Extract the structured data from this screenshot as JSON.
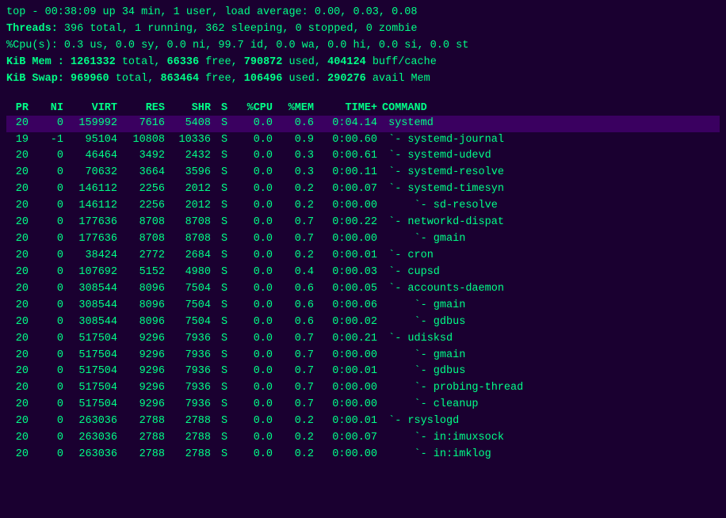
{
  "header": {
    "line1": "top - 00:38:09 up 34 min,  1 user,  load average: 0.00, 0.03, 0.08",
    "line2_label1": "Threads:",
    "line2_val1": " 396 total,",
    "line2_label2": "  1 running,",
    "line2_val2": " 362 sleeping,",
    "line2_label3": "  0 stopped,",
    "line2_val3": "  0 zombie",
    "line3": "%Cpu(s):  0.3 us,  0.0 sy,  0.0 ni, 99.7 id,  0.0 wa,  0.0 hi,  0.0 si,  0.0 st",
    "line4_label1": "KiB Mem :",
    "line4_val1": " 1261332",
    "line4_label2": " total,",
    "line4_val2": "    66336",
    "line4_label3": " free,",
    "line4_val3": "   790872",
    "line4_label4": " used,",
    "line4_val4": "   404124",
    "line4_label5": " buff/cache",
    "line5_label1": "KiB Swap:",
    "line5_val1": "  969960",
    "line5_label2": " total,",
    "line5_val2": "   863464",
    "line5_label3": " free,",
    "line5_val3": "   106496",
    "line5_label4": " used.",
    "line5_val4": "   290276",
    "line5_label5": " avail Mem"
  },
  "columns": [
    "PR",
    "NI",
    "VIRT",
    "RES",
    "SHR",
    "S",
    "%CPU",
    "%MEM",
    "TIME+",
    "COMMAND"
  ],
  "rows": [
    {
      "pr": "20",
      "ni": "0",
      "virt": "159992",
      "res": "7616",
      "shr": "5408",
      "s": "S",
      "cpu": "0.0",
      "mem": "0.6",
      "time": "0:04.14",
      "cmd": "systemd",
      "highlight": true
    },
    {
      "pr": "19",
      "ni": "-1",
      "virt": "95104",
      "res": "10808",
      "shr": "10336",
      "s": "S",
      "cpu": "0.0",
      "mem": "0.9",
      "time": "0:00.60",
      "cmd": "`- systemd-journal"
    },
    {
      "pr": "20",
      "ni": "0",
      "virt": "46464",
      "res": "3492",
      "shr": "2432",
      "s": "S",
      "cpu": "0.0",
      "mem": "0.3",
      "time": "0:00.61",
      "cmd": "`- systemd-udevd"
    },
    {
      "pr": "20",
      "ni": "0",
      "virt": "70632",
      "res": "3664",
      "shr": "3596",
      "s": "S",
      "cpu": "0.0",
      "mem": "0.3",
      "time": "0:00.11",
      "cmd": "`- systemd-resolve"
    },
    {
      "pr": "20",
      "ni": "0",
      "virt": "146112",
      "res": "2256",
      "shr": "2012",
      "s": "S",
      "cpu": "0.0",
      "mem": "0.2",
      "time": "0:00.07",
      "cmd": "`- systemd-timesyn"
    },
    {
      "pr": "20",
      "ni": "0",
      "virt": "146112",
      "res": "2256",
      "shr": "2012",
      "s": "S",
      "cpu": "0.0",
      "mem": "0.2",
      "time": "0:00.00",
      "cmd": "    `- sd-resolve"
    },
    {
      "pr": "20",
      "ni": "0",
      "virt": "177636",
      "res": "8708",
      "shr": "8708",
      "s": "S",
      "cpu": "0.0",
      "mem": "0.7",
      "time": "0:00.22",
      "cmd": "`- networkd-dispat"
    },
    {
      "pr": "20",
      "ni": "0",
      "virt": "177636",
      "res": "8708",
      "shr": "8708",
      "s": "S",
      "cpu": "0.0",
      "mem": "0.7",
      "time": "0:00.00",
      "cmd": "    `- gmain"
    },
    {
      "pr": "20",
      "ni": "0",
      "virt": "38424",
      "res": "2772",
      "shr": "2684",
      "s": "S",
      "cpu": "0.0",
      "mem": "0.2",
      "time": "0:00.01",
      "cmd": "`- cron"
    },
    {
      "pr": "20",
      "ni": "0",
      "virt": "107692",
      "res": "5152",
      "shr": "4980",
      "s": "S",
      "cpu": "0.0",
      "mem": "0.4",
      "time": "0:00.03",
      "cmd": "`- cupsd"
    },
    {
      "pr": "20",
      "ni": "0",
      "virt": "308544",
      "res": "8096",
      "shr": "7504",
      "s": "S",
      "cpu": "0.0",
      "mem": "0.6",
      "time": "0:00.05",
      "cmd": "`- accounts-daemon"
    },
    {
      "pr": "20",
      "ni": "0",
      "virt": "308544",
      "res": "8096",
      "shr": "7504",
      "s": "S",
      "cpu": "0.0",
      "mem": "0.6",
      "time": "0:00.06",
      "cmd": "    `- gmain"
    },
    {
      "pr": "20",
      "ni": "0",
      "virt": "308544",
      "res": "8096",
      "shr": "7504",
      "s": "S",
      "cpu": "0.0",
      "mem": "0.6",
      "time": "0:00.02",
      "cmd": "    `- gdbus"
    },
    {
      "pr": "20",
      "ni": "0",
      "virt": "517504",
      "res": "9296",
      "shr": "7936",
      "s": "S",
      "cpu": "0.0",
      "mem": "0.7",
      "time": "0:00.21",
      "cmd": "`- udisksd"
    },
    {
      "pr": "20",
      "ni": "0",
      "virt": "517504",
      "res": "9296",
      "shr": "7936",
      "s": "S",
      "cpu": "0.0",
      "mem": "0.7",
      "time": "0:00.00",
      "cmd": "    `- gmain"
    },
    {
      "pr": "20",
      "ni": "0",
      "virt": "517504",
      "res": "9296",
      "shr": "7936",
      "s": "S",
      "cpu": "0.0",
      "mem": "0.7",
      "time": "0:00.01",
      "cmd": "    `- gdbus"
    },
    {
      "pr": "20",
      "ni": "0",
      "virt": "517504",
      "res": "9296",
      "shr": "7936",
      "s": "S",
      "cpu": "0.0",
      "mem": "0.7",
      "time": "0:00.00",
      "cmd": "    `- probing-thread"
    },
    {
      "pr": "20",
      "ni": "0",
      "virt": "517504",
      "res": "9296",
      "shr": "7936",
      "s": "S",
      "cpu": "0.0",
      "mem": "0.7",
      "time": "0:00.00",
      "cmd": "    `- cleanup"
    },
    {
      "pr": "20",
      "ni": "0",
      "virt": "263036",
      "res": "2788",
      "shr": "2788",
      "s": "S",
      "cpu": "0.0",
      "mem": "0.2",
      "time": "0:00.01",
      "cmd": "`- rsyslogd"
    },
    {
      "pr": "20",
      "ni": "0",
      "virt": "263036",
      "res": "2788",
      "shr": "2788",
      "s": "S",
      "cpu": "0.0",
      "mem": "0.2",
      "time": "0:00.07",
      "cmd": "    `- in:imuxsock"
    },
    {
      "pr": "20",
      "ni": "0",
      "virt": "263036",
      "res": "2788",
      "shr": "2788",
      "s": "S",
      "cpu": "0.0",
      "mem": "0.2",
      "time": "0:00.00",
      "cmd": "    `- in:imklog"
    }
  ]
}
